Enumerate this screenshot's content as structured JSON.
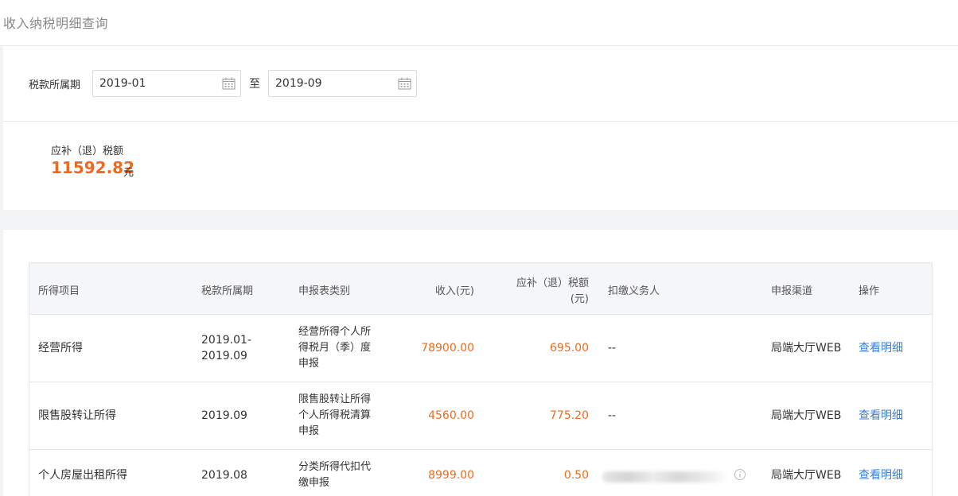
{
  "header": {
    "title": "收入纳税明细查询"
  },
  "filter": {
    "label": "税款所属期",
    "start": "2019-01",
    "separator": "至",
    "end": "2019-09"
  },
  "summary": {
    "label": "应补（退）税额",
    "amount": "11592.82",
    "unit": "元"
  },
  "table": {
    "columns": [
      "所得项目",
      "税款所属期",
      "申报表类别",
      "收入(元)",
      "应补（退）税额",
      "(元)",
      "扣缴义务人",
      "申报渠道",
      "操作"
    ],
    "rows": [
      {
        "item": "经营所得",
        "period_line1": "2019.01-",
        "period_line2": "2019.09",
        "form_line1": "经营所得个人所",
        "form_line2": "得税月（季）度",
        "form_line3": "申报",
        "income": "78900.00",
        "tax": "695.00",
        "withholder": "--",
        "channel": "局端大厅WEB",
        "action": "查看明细"
      },
      {
        "item": "限售股转让所得",
        "period": "2019.09",
        "form_line1": "限售股转让所得",
        "form_line2": "个人所得税清算",
        "form_line3": "申报",
        "income": "4560.00",
        "tax": "775.20",
        "withholder": "--",
        "channel": "局端大厅WEB",
        "action": "查看明细"
      },
      {
        "item": "个人房屋出租所得",
        "period": "2019.08",
        "form_line1": "分类所得代扣代",
        "form_line2": "缴申报",
        "income": "8999.00",
        "tax": "0.50",
        "channel": "局端大厅WEB",
        "action": "查看明细"
      }
    ]
  },
  "colors": {
    "accent": "#f06a1d",
    "link": "#3b7fd6"
  },
  "icons": [
    "calendar-icon",
    "info-icon"
  ]
}
